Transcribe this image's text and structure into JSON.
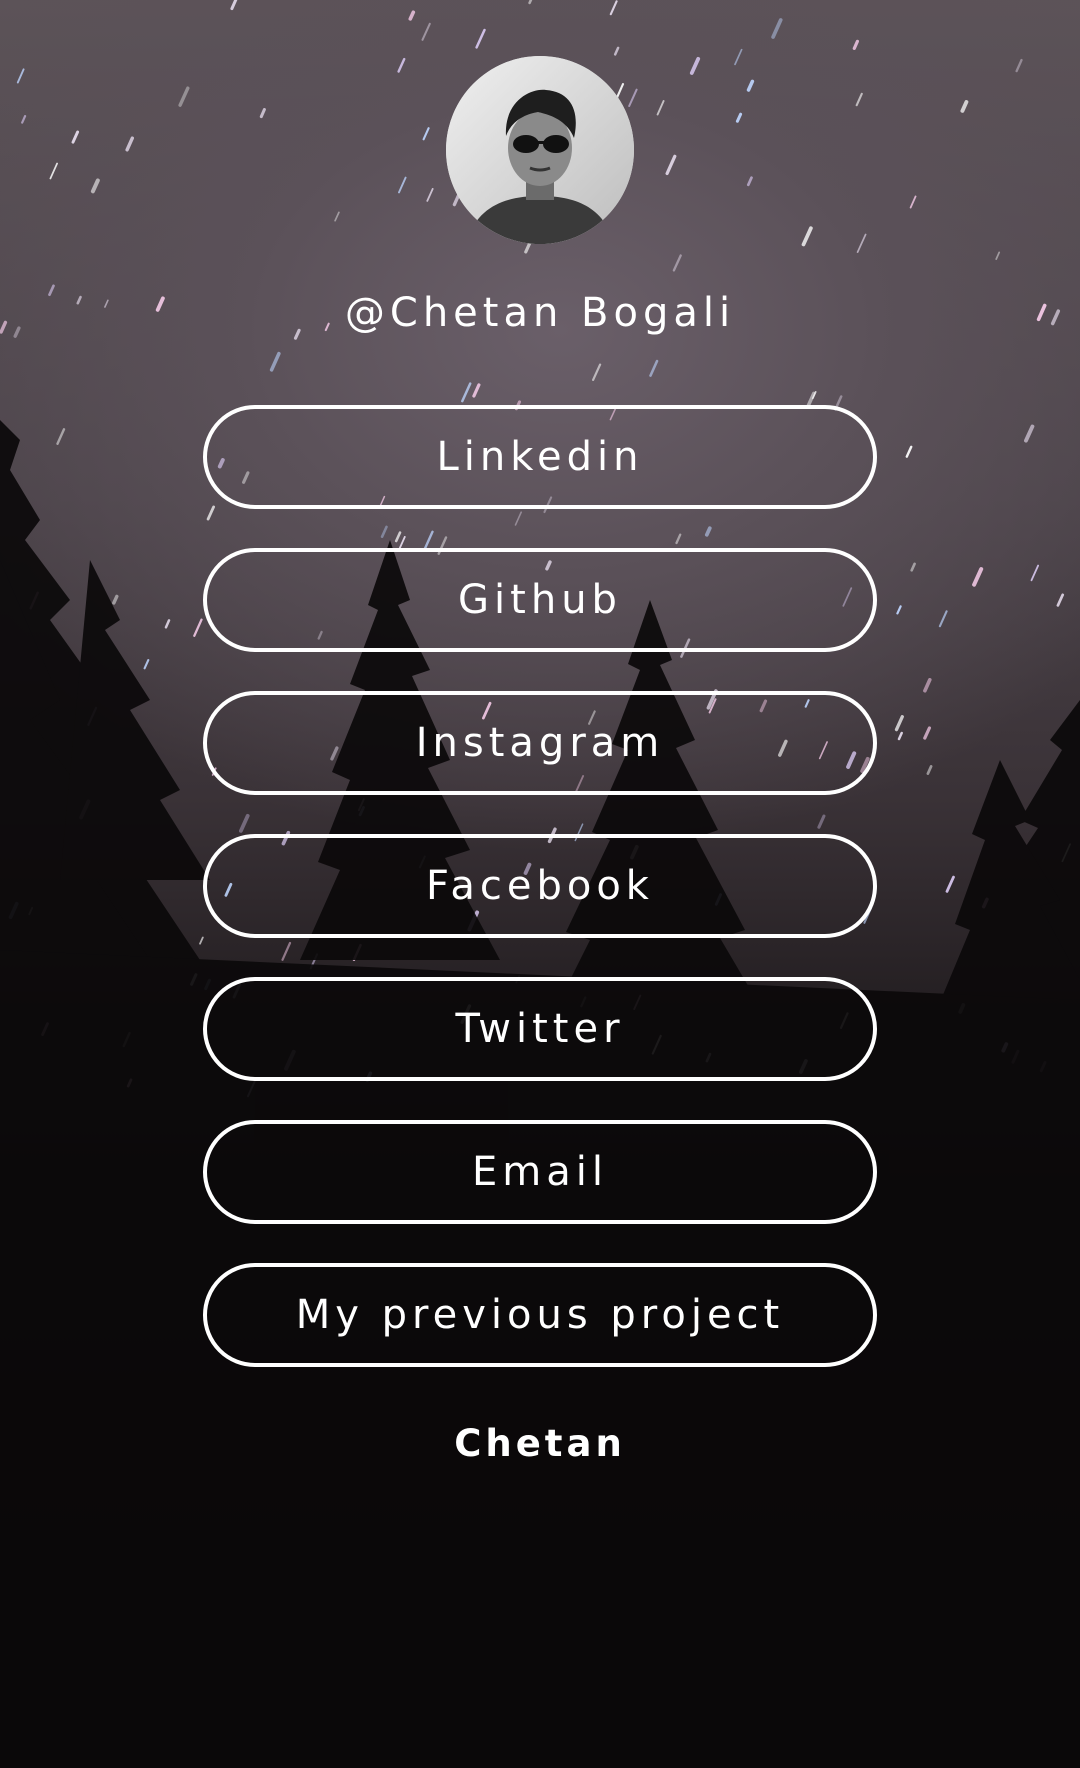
{
  "profile": {
    "handle": "@Chetan Bogali",
    "avatar_icon": "profile-photo-icon"
  },
  "links": [
    {
      "label": "Linkedin"
    },
    {
      "label": "Github"
    },
    {
      "label": "Instagram"
    },
    {
      "label": "Facebook"
    },
    {
      "label": "Twitter"
    },
    {
      "label": "Email"
    },
    {
      "label": "My previous project"
    }
  ],
  "footer": {
    "name": "Chetan"
  },
  "colors": {
    "text": "#ffffff",
    "button_border": "#ffffff",
    "background_top": "#5c5358",
    "background_bottom": "#0a0809"
  }
}
